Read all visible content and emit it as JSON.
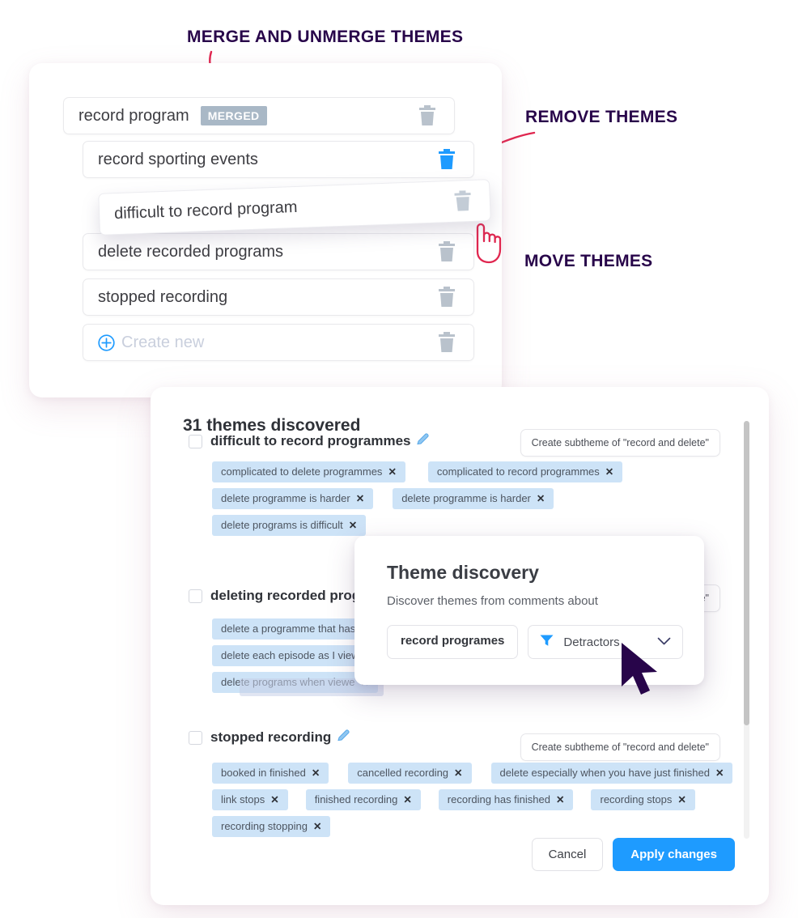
{
  "annotations": [
    {
      "id": "merge",
      "text": "MERGE AND UNMERGE THEMES"
    },
    {
      "id": "remove",
      "text": "REMOVE THEMES"
    },
    {
      "id": "move",
      "text": "MOVE THEMES"
    }
  ],
  "colors": {
    "annotation_text": "#28054a",
    "arrow": "#e0264f",
    "accent_blue": "#1e9bff",
    "tag_blue": "#cde3f7",
    "merged_badge": "#a9b8c6",
    "cursor": "#28054a"
  },
  "theme_editor": {
    "rows": [
      {
        "label": "record program",
        "badge": "MERGED",
        "trash_icon": "trash-icon",
        "trash_active": false,
        "indent": 0
      },
      {
        "label": "record sporting events",
        "badge": "",
        "trash_icon": "trash-icon",
        "trash_active": true,
        "indent": 1
      },
      {
        "label": "difficult to record program",
        "badge": "",
        "trash_icon": "trash-icon",
        "trash_active": false,
        "indent": 1,
        "floating": true
      },
      {
        "label": "delete recorded programs",
        "badge": "",
        "trash_icon": "trash-icon",
        "trash_active": false,
        "indent": 1
      },
      {
        "label": "stopped recording",
        "badge": "",
        "trash_icon": "trash-icon",
        "trash_active": false,
        "indent": 1
      },
      {
        "label": "Create new",
        "badge": "",
        "trash_icon": "trash-icon",
        "trash_active": false,
        "indent": 1,
        "plus_icon": "plus-circle-icon"
      }
    ]
  },
  "panel": {
    "title": "31 themes discovered",
    "subtheme_button_label": "Create subtheme of \"record and delete\"",
    "edit_icon": "pencil-icon",
    "themes": [
      {
        "name": "difficult to record programmes",
        "tag_rows": [
          [
            "complicated to delete programmes",
            "complicated to record programmes"
          ],
          [
            "delete programme is harder",
            "delete programme is harder"
          ],
          [
            "delete programs is difficult"
          ]
        ]
      },
      {
        "name": "deleting recorded progr",
        "tag_rows": [
          [
            "delete a programme that has"
          ],
          [
            "delete each episode as I view"
          ],
          [
            "delete programs when viewe"
          ]
        ]
      },
      {
        "name": "stopped recording",
        "tag_rows": [
          [
            "booked in finished",
            "cancelled recording",
            "delete especially when you have just finished"
          ],
          [
            "link stops",
            "finished recording",
            "recording has finished",
            "recording stops"
          ],
          [
            "recording stopping"
          ]
        ]
      }
    ],
    "footer": {
      "cancel_label": "Cancel",
      "apply_label": "Apply changes"
    }
  },
  "modal": {
    "title": "Theme discovery",
    "subtitle": "Discover themes from comments about",
    "topic_value": "record programes",
    "segment_value": "Detractors",
    "filter_icon": "funnel-icon",
    "chevron_icon": "chevron-down-icon"
  }
}
